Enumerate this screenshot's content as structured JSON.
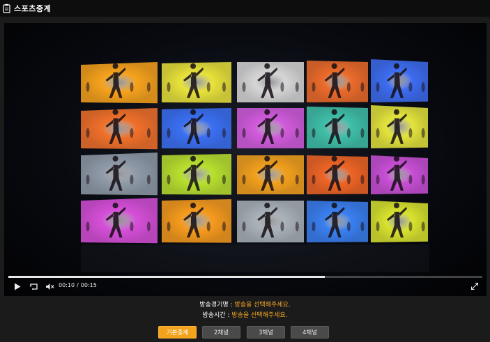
{
  "window": {
    "title": "스포츠중계",
    "icon": "clipboard-icon"
  },
  "player": {
    "current_time": "00:10",
    "separator": "/",
    "duration": "00:15",
    "progress_fraction": 0.667
  },
  "info": {
    "game_label": "방송경기명",
    "game_value": "방송을 선택해주세요.",
    "time_label": "방송시간",
    "time_value": "방송을 선택해주세요.",
    "colon": " : "
  },
  "channels": [
    {
      "label": "기본중계",
      "active": true
    },
    {
      "label": "2채널",
      "active": false
    },
    {
      "label": "3채널",
      "active": false
    },
    {
      "label": "4채널",
      "active": false
    }
  ],
  "colors": {
    "accent": "#f2a31b",
    "info_value": "#f5a623"
  }
}
